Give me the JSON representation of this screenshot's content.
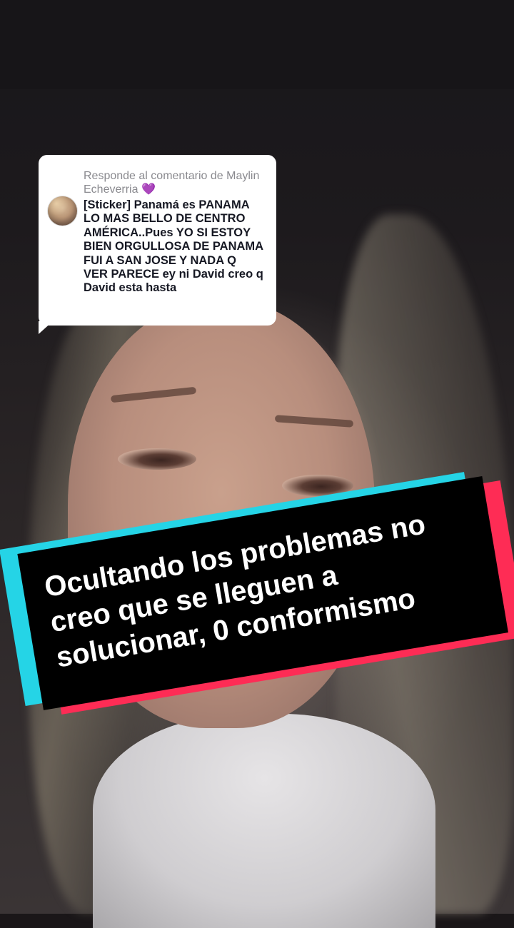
{
  "comment": {
    "header": "Responde al comentario de",
    "author": "Maylin Echeverria",
    "author_emoji": "💜",
    "text": "[Sticker] Panamá es PANAMA LO MAS BELLO DE CENTRO AMÉRICA..Pues YO SI ESTOY BIEN ORGULLOSA DE PANAMA FUI A SAN JOSE Y NADA Q VER PARECE ey ni David creo q David esta hasta"
  },
  "caption": {
    "text": "Ocultando los problemas no creo que se lleguen a solucionar, 0 conformismo"
  },
  "colors": {
    "caption_background": "#000000",
    "caption_cyan": "#25d4e6",
    "caption_red": "#fe2c55",
    "bubble_background": "#ffffff",
    "comment_header": "#8a8a8f"
  }
}
